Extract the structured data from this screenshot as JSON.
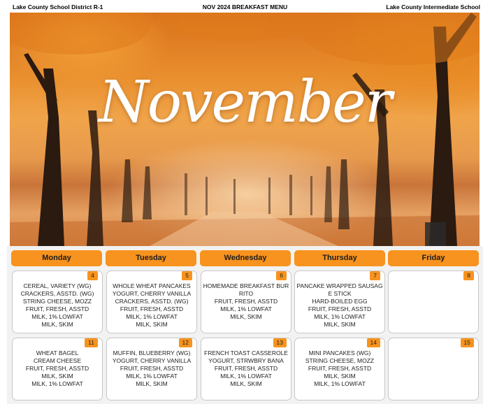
{
  "header": {
    "district": "Lake County School District R-1",
    "menu_title": "NOV 2024 BREAKFAST MENU",
    "school": "Lake County Intermediate School"
  },
  "hero": {
    "title": "November"
  },
  "days": [
    "Monday",
    "Tuesday",
    "Wednesday",
    "Thursday",
    "Friday"
  ],
  "week1": [
    {
      "date": "4",
      "items": [
        "CEREAL, VARIETY (WG)",
        "CRACKERS, ASSTD. (WG)",
        "STRING CHEESE, MOZZ",
        "FRUIT, FRESH, ASSTD",
        "MILK, 1% LOWFAT",
        "MILK, SKIM"
      ]
    },
    {
      "date": "5",
      "items": [
        "WHOLE WHEAT PANCAKES",
        "YOGURT, CHERRY VANILLA",
        "CRACKERS, ASSTD. (WG)",
        "FRUIT, FRESH, ASSTD",
        "MILK, 1% LOWFAT",
        "MILK, SKIM"
      ]
    },
    {
      "date": "6",
      "items": [
        "HOMEMADE BREAKFAST BURRITO",
        "FRUIT, FRESH, ASSTD",
        "MILK, 1% LOWFAT",
        "MILK, SKIM"
      ]
    },
    {
      "date": "7",
      "items": [
        "PANCAKE WRAPPED SAUSAGE STICK",
        "HARD-BOILED EGG",
        "FRUIT, FRESH, ASSTD",
        "MILK, 1% LOWFAT",
        "MILK, SKIM"
      ]
    },
    {
      "date": "8",
      "items": []
    }
  ],
  "week2": [
    {
      "date": "11",
      "items": [
        "WHEAT BAGEL",
        "CREAM CHEESE",
        "FRUIT, FRESH, ASSTD",
        "MILK, SKIM",
        "MILK, 1% LOWFAT"
      ]
    },
    {
      "date": "12",
      "items": [
        "MUFFIN, BLUEBERRY (WG)",
        "YOGURT, CHERRY VANILLA",
        "FRUIT, FRESH, ASSTD",
        "MILK, 1% LOWFAT",
        "MILK, SKIM"
      ]
    },
    {
      "date": "13",
      "items": [
        "FRENCH TOAST CASSEROLE",
        "YOGURT, STRWBRY BANA",
        "FRUIT, FRESH, ASSTD",
        "MILK, 1% LOWFAT",
        "MILK, SKIM"
      ]
    },
    {
      "date": "14",
      "items": [
        "MINI PANCAKES (WG)",
        "STRING CHEESE, MOZZ",
        "FRUIT, FRESH, ASSTD",
        "MILK, SKIM",
        "MILK, 1% LOWFAT"
      ]
    },
    {
      "date": "15",
      "items": []
    }
  ],
  "colors": {
    "accent": "#f7931e",
    "calendar_bg": "#f2f2f2"
  }
}
